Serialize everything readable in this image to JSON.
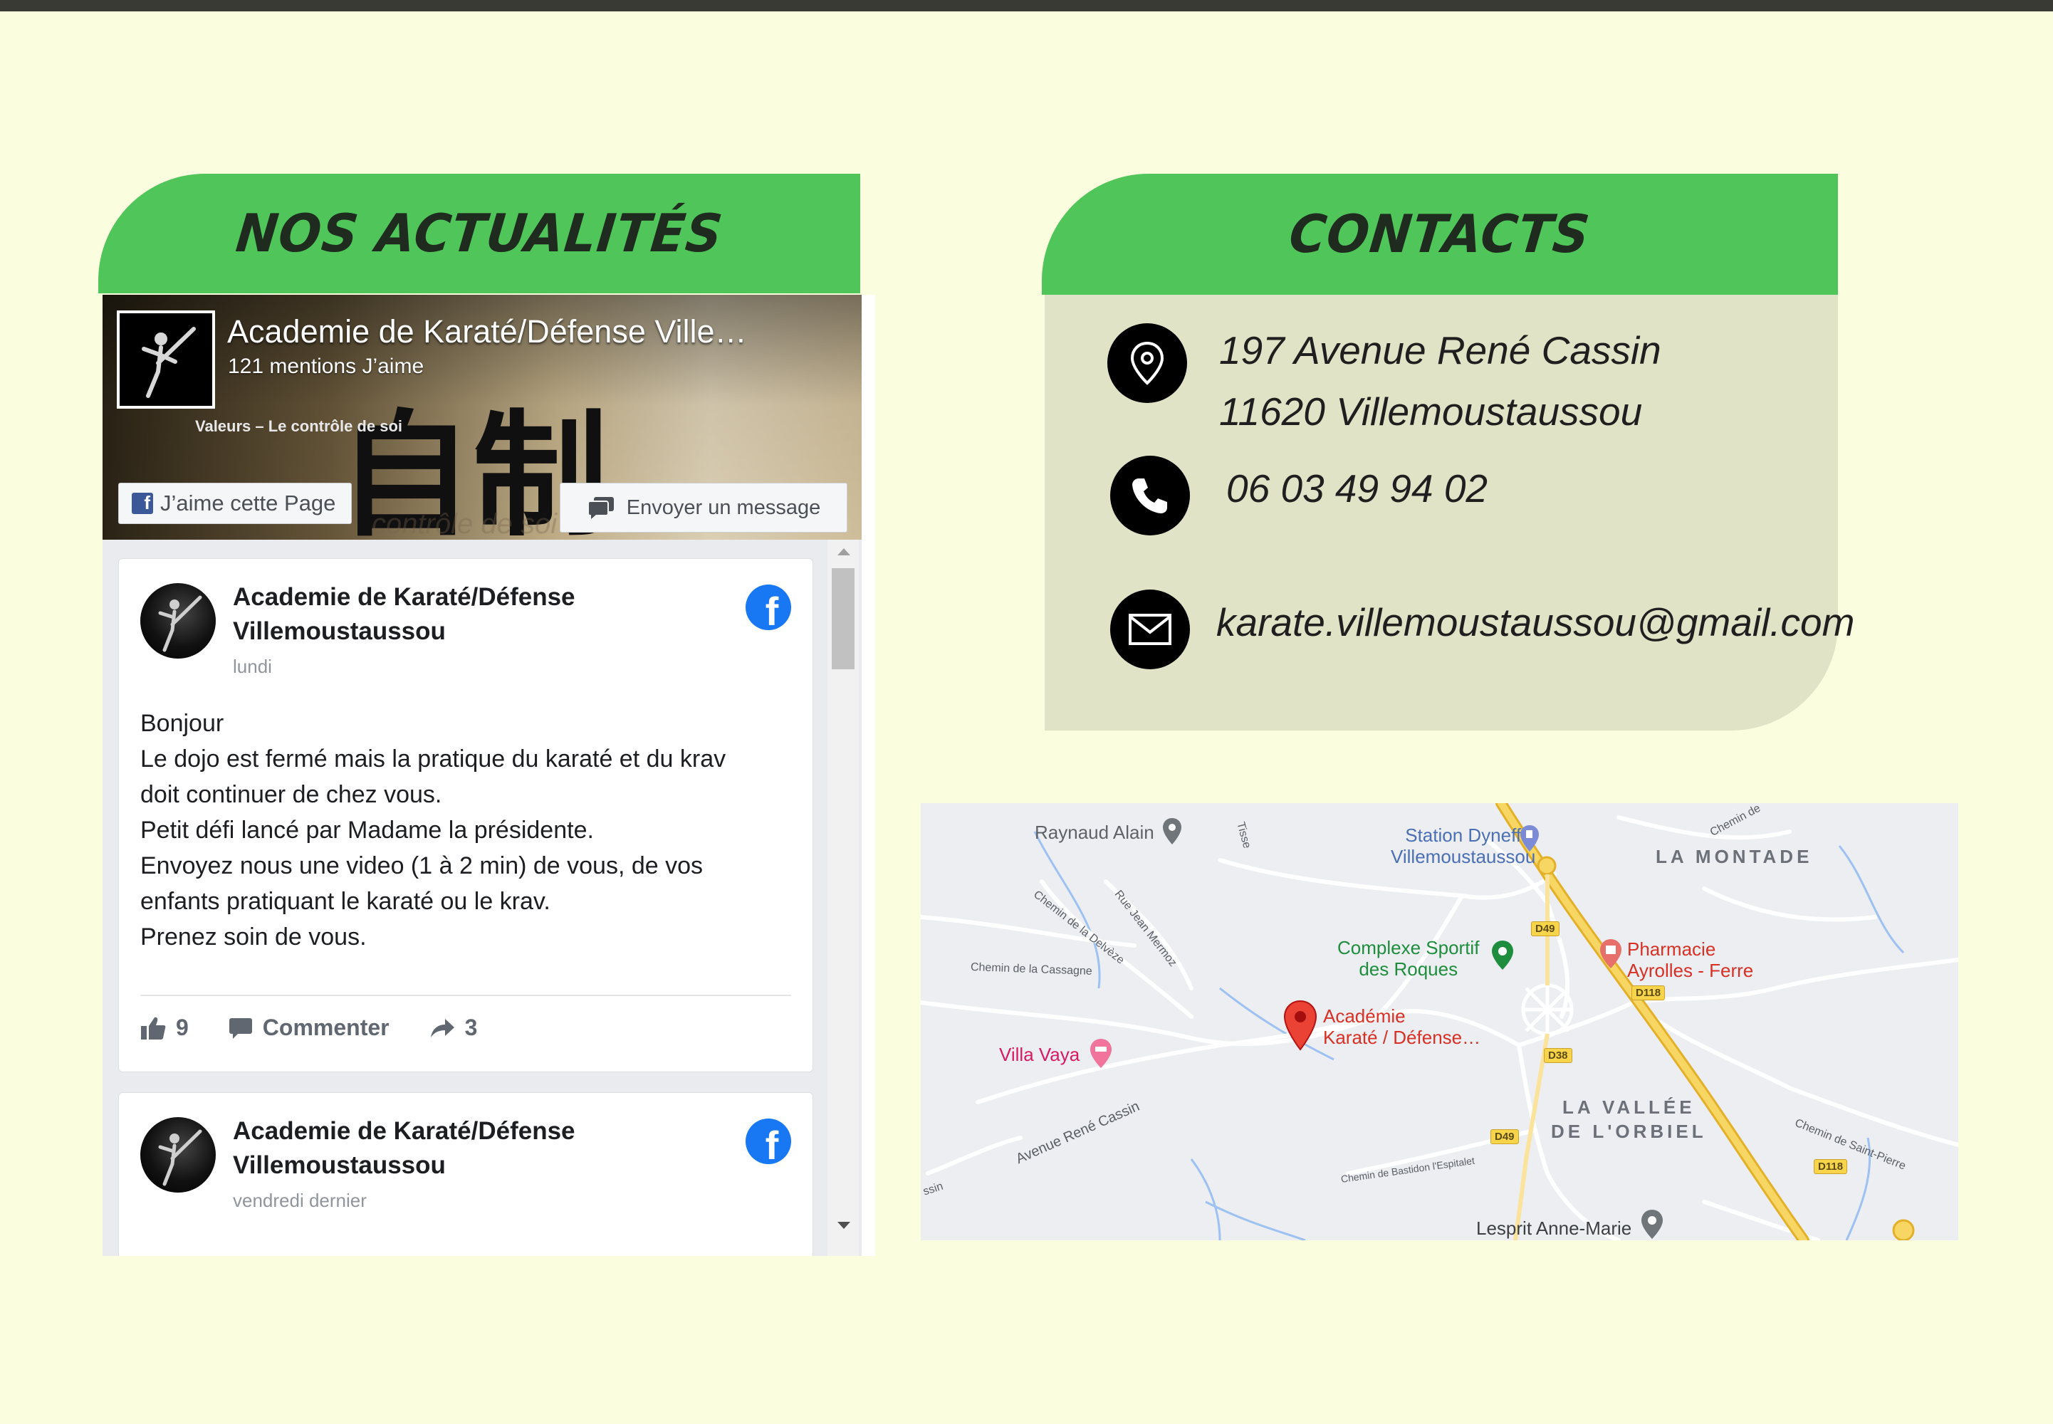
{
  "news": {
    "title": "NOS ACTUALITÉS",
    "facebook": {
      "page_name": "Academie de Karaté/Défense Ville…",
      "likes": "121 mentions J’aime",
      "cover_motto": "Valeurs – Le contrôle de soi",
      "cover_watermark": "contrôle de soi",
      "cover_kanji": [
        "自",
        "制"
      ],
      "like_page_label": "J’aime cette Page",
      "message_label": "Envoyer un message",
      "posts": [
        {
          "author": "Academie de Karaté/Défense Villemoustaussou",
          "date": "lundi",
          "body": [
            "Bonjour",
            "Le dojo est fermé mais la pratique du karaté et du krav",
            "doit continuer de chez vous.",
            "Petit défi lancé par Madame la présidente.",
            "Envoyez nous une video (1 à 2 min) de vous, de vos",
            "enfants pratiquant le karaté ou le krav.",
            "Prenez soin de vous."
          ],
          "likes": "9",
          "comment_label": "Commenter",
          "shares": "3"
        },
        {
          "author": "Academie de Karaté/Défense Villemoustaussou",
          "date": "vendredi dernier"
        }
      ]
    }
  },
  "contacts": {
    "title": "CONTACTS",
    "address_line1": "197 Avenue René Cassin",
    "address_line2": "11620 Villemoustaussou",
    "phone": "06 03 49 94 02",
    "email": "karate.villemoustaussou@gmail.com",
    "icons": [
      "location-pin-icon",
      "phone-icon",
      "envelope-icon"
    ]
  },
  "map": {
    "places": {
      "raynaud": "Raynaud Alain",
      "station_1": "Station Dyneff",
      "station_2": "Villemoustaussou",
      "complexe_1": "Complexe Sportif",
      "complexe_2": "des Roques",
      "pharmacie_1": "Pharmacie",
      "pharmacie_2": "Ayrolles - Ferre",
      "academie_1": "Académie",
      "academie_2": "Karaté / Défense…",
      "villa": "Villa Vaya",
      "lesprit": "Lesprit Anne-Marie"
    },
    "areas": {
      "montade": "LA MONTADE",
      "vallee_1": "LA VALLÉE",
      "vallee_2": "DE L'ORBIEL"
    },
    "roads": {
      "d49a": "D49",
      "d118a": "D118",
      "d38": "D38",
      "d49b": "D49",
      "d118b": "D118"
    },
    "streets": {
      "delveze": "Chemin de la Delvèze",
      "mermoz": "Rue Jean Mermoz",
      "cassagne": "Chemin de la Cassagne",
      "cassin": "Avenue René Cassin",
      "saint_pierre": "Chemin de Saint-Pierre",
      "bastidon": "Chemin de Bastidon l'Espitalet",
      "chemin_de": "Chemin de",
      "ssin": "ssin",
      "tisse": "Tisse"
    },
    "colors": {
      "main_road": "#f4c542",
      "poi_green": "#1e8e3e",
      "poi_red": "#d93025",
      "poi_blue": "#4a6fb5",
      "poi_pink": "#d81b60"
    }
  },
  "colors": {
    "background": "#fbfede",
    "header_green": "#4fc55a",
    "contact_card": "#e0e3c6"
  }
}
